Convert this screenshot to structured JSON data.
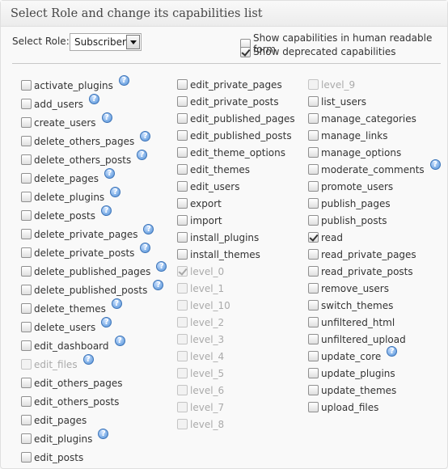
{
  "header": {
    "title": "Select Role and change its capabilities list"
  },
  "role": {
    "label": "Select Role:",
    "selected": "Subscriber"
  },
  "options": {
    "human_readable": {
      "label": "Show capabilities in human readable form",
      "checked": false
    },
    "deprecated": {
      "label": "Show deprecated capabilities",
      "checked": true
    }
  },
  "columns": [
    [
      {
        "label": "activate_plugins",
        "checked": false,
        "disabled": false,
        "help": true
      },
      {
        "label": "add_users",
        "checked": false,
        "disabled": false,
        "help": true
      },
      {
        "label": "create_users",
        "checked": false,
        "disabled": false,
        "help": true
      },
      {
        "label": "delete_others_pages",
        "checked": false,
        "disabled": false,
        "help": true
      },
      {
        "label": "delete_others_posts",
        "checked": false,
        "disabled": false,
        "help": true
      },
      {
        "label": "delete_pages",
        "checked": false,
        "disabled": false,
        "help": true
      },
      {
        "label": "delete_plugins",
        "checked": false,
        "disabled": false,
        "help": true
      },
      {
        "label": "delete_posts",
        "checked": false,
        "disabled": false,
        "help": true
      },
      {
        "label": "delete_private_pages",
        "checked": false,
        "disabled": false,
        "help": true
      },
      {
        "label": "delete_private_posts",
        "checked": false,
        "disabled": false,
        "help": true
      },
      {
        "label": "delete_published_pages",
        "checked": false,
        "disabled": false,
        "help": true
      },
      {
        "label": "delete_published_posts",
        "checked": false,
        "disabled": false,
        "help": true
      },
      {
        "label": "delete_themes",
        "checked": false,
        "disabled": false,
        "help": true
      },
      {
        "label": "delete_users",
        "checked": false,
        "disabled": false,
        "help": true
      },
      {
        "label": "edit_dashboard",
        "checked": false,
        "disabled": false,
        "help": true
      },
      {
        "label": "edit_files",
        "checked": false,
        "disabled": true,
        "help": true
      },
      {
        "label": "edit_others_pages",
        "checked": false,
        "disabled": false,
        "help": false
      },
      {
        "label": "edit_others_posts",
        "checked": false,
        "disabled": false,
        "help": false
      },
      {
        "label": "edit_pages",
        "checked": false,
        "disabled": false,
        "help": false
      },
      {
        "label": "edit_plugins",
        "checked": false,
        "disabled": false,
        "help": true
      },
      {
        "label": "edit_posts",
        "checked": false,
        "disabled": false,
        "help": false
      }
    ],
    [
      {
        "label": "edit_private_pages",
        "checked": false,
        "disabled": false,
        "help": false
      },
      {
        "label": "edit_private_posts",
        "checked": false,
        "disabled": false,
        "help": false
      },
      {
        "label": "edit_published_pages",
        "checked": false,
        "disabled": false,
        "help": false
      },
      {
        "label": "edit_published_posts",
        "checked": false,
        "disabled": false,
        "help": false
      },
      {
        "label": "edit_theme_options",
        "checked": false,
        "disabled": false,
        "help": false
      },
      {
        "label": "edit_themes",
        "checked": false,
        "disabled": false,
        "help": false
      },
      {
        "label": "edit_users",
        "checked": false,
        "disabled": false,
        "help": false
      },
      {
        "label": "export",
        "checked": false,
        "disabled": false,
        "help": false
      },
      {
        "label": "import",
        "checked": false,
        "disabled": false,
        "help": false
      },
      {
        "label": "install_plugins",
        "checked": false,
        "disabled": false,
        "help": false
      },
      {
        "label": "install_themes",
        "checked": false,
        "disabled": false,
        "help": false
      },
      {
        "label": "level_0",
        "checked": true,
        "disabled": true,
        "help": false
      },
      {
        "label": "level_1",
        "checked": false,
        "disabled": true,
        "help": false
      },
      {
        "label": "level_10",
        "checked": false,
        "disabled": true,
        "help": false
      },
      {
        "label": "level_2",
        "checked": false,
        "disabled": true,
        "help": false
      },
      {
        "label": "level_3",
        "checked": false,
        "disabled": true,
        "help": false
      },
      {
        "label": "level_4",
        "checked": false,
        "disabled": true,
        "help": false
      },
      {
        "label": "level_5",
        "checked": false,
        "disabled": true,
        "help": false
      },
      {
        "label": "level_6",
        "checked": false,
        "disabled": true,
        "help": false
      },
      {
        "label": "level_7",
        "checked": false,
        "disabled": true,
        "help": false
      },
      {
        "label": "level_8",
        "checked": false,
        "disabled": true,
        "help": false
      }
    ],
    [
      {
        "label": "level_9",
        "checked": false,
        "disabled": true,
        "help": false
      },
      {
        "label": "list_users",
        "checked": false,
        "disabled": false,
        "help": false
      },
      {
        "label": "manage_categories",
        "checked": false,
        "disabled": false,
        "help": false
      },
      {
        "label": "manage_links",
        "checked": false,
        "disabled": false,
        "help": false
      },
      {
        "label": "manage_options",
        "checked": false,
        "disabled": false,
        "help": false
      },
      {
        "label": "moderate_comments",
        "checked": false,
        "disabled": false,
        "help": true
      },
      {
        "label": "promote_users",
        "checked": false,
        "disabled": false,
        "help": false
      },
      {
        "label": "publish_pages",
        "checked": false,
        "disabled": false,
        "help": false
      },
      {
        "label": "publish_posts",
        "checked": false,
        "disabled": false,
        "help": false
      },
      {
        "label": "read",
        "checked": true,
        "disabled": false,
        "help": false
      },
      {
        "label": "read_private_pages",
        "checked": false,
        "disabled": false,
        "help": false
      },
      {
        "label": "read_private_posts",
        "checked": false,
        "disabled": false,
        "help": false
      },
      {
        "label": "remove_users",
        "checked": false,
        "disabled": false,
        "help": false
      },
      {
        "label": "switch_themes",
        "checked": false,
        "disabled": false,
        "help": false
      },
      {
        "label": "unfiltered_html",
        "checked": false,
        "disabled": false,
        "help": false
      },
      {
        "label": "unfiltered_upload",
        "checked": false,
        "disabled": false,
        "help": false
      },
      {
        "label": "update_core",
        "checked": false,
        "disabled": false,
        "help": true
      },
      {
        "label": "update_plugins",
        "checked": false,
        "disabled": false,
        "help": false
      },
      {
        "label": "update_themes",
        "checked": false,
        "disabled": false,
        "help": false
      },
      {
        "label": "upload_files",
        "checked": false,
        "disabled": false,
        "help": false
      }
    ]
  ],
  "help_icon_glyph": "?"
}
